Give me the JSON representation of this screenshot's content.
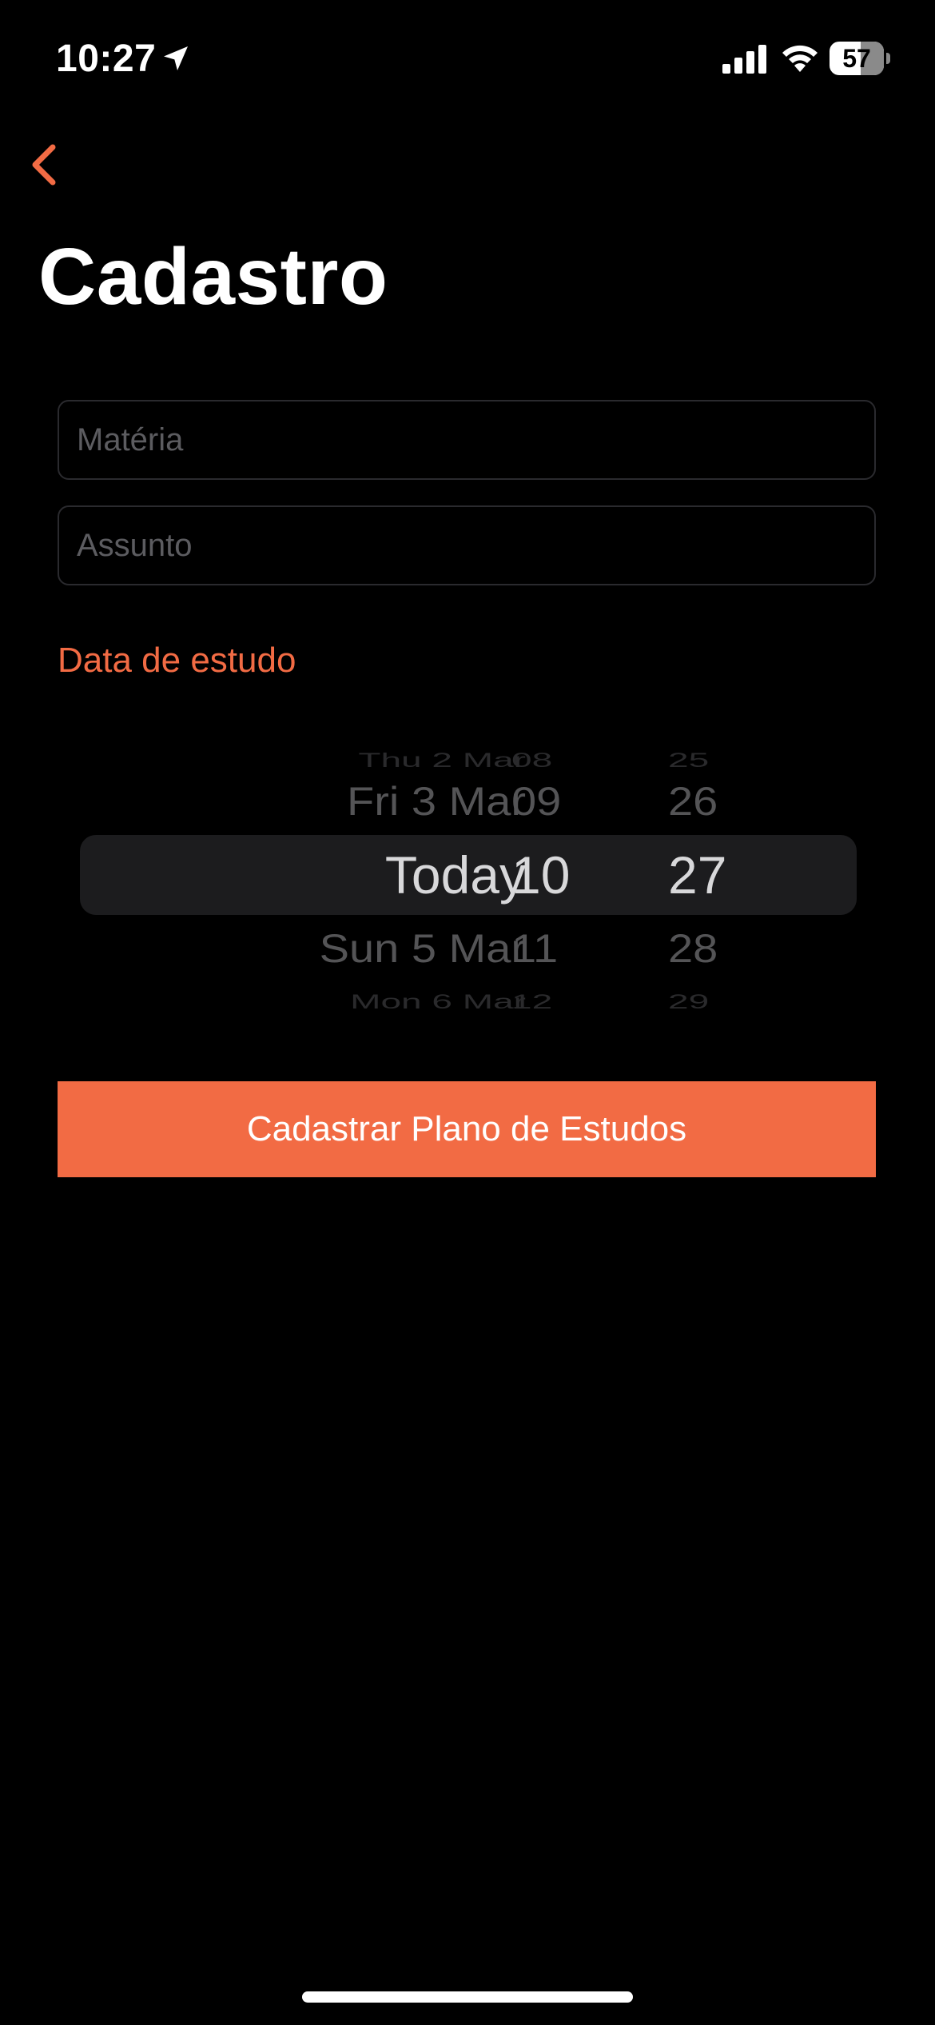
{
  "status_bar": {
    "time": "10:27",
    "battery_level": "57",
    "battery_percent": 57,
    "icons": [
      "location-arrow-icon",
      "cellular-signal-icon",
      "wifi-icon",
      "battery-icon"
    ]
  },
  "nav": {
    "back_icon": "chevron-left-icon",
    "title": "Cadastro"
  },
  "form": {
    "materia": {
      "placeholder": "Matéria",
      "value": ""
    },
    "assunto": {
      "placeholder": "Assunto",
      "value": ""
    },
    "date_label": "Data de estudo",
    "date_picker": {
      "rows": [
        {
          "date": "Thu 2 Mar",
          "hour": "08",
          "minute": "25"
        },
        {
          "date": "Fri 3 Mar",
          "hour": "09",
          "minute": "26"
        },
        {
          "date": "Today",
          "hour": "10",
          "minute": "27"
        },
        {
          "date": "Sun 5 Mar",
          "hour": "11",
          "minute": "28"
        },
        {
          "date": "Mon 6 Mar",
          "hour": "12",
          "minute": "29"
        }
      ],
      "selected_index": 2
    },
    "submit_label": "Cadastrar Plano de Estudos"
  },
  "colors": {
    "accent": "#f26b44",
    "background": "#000000",
    "picker_highlight": "#1c1c1e"
  }
}
